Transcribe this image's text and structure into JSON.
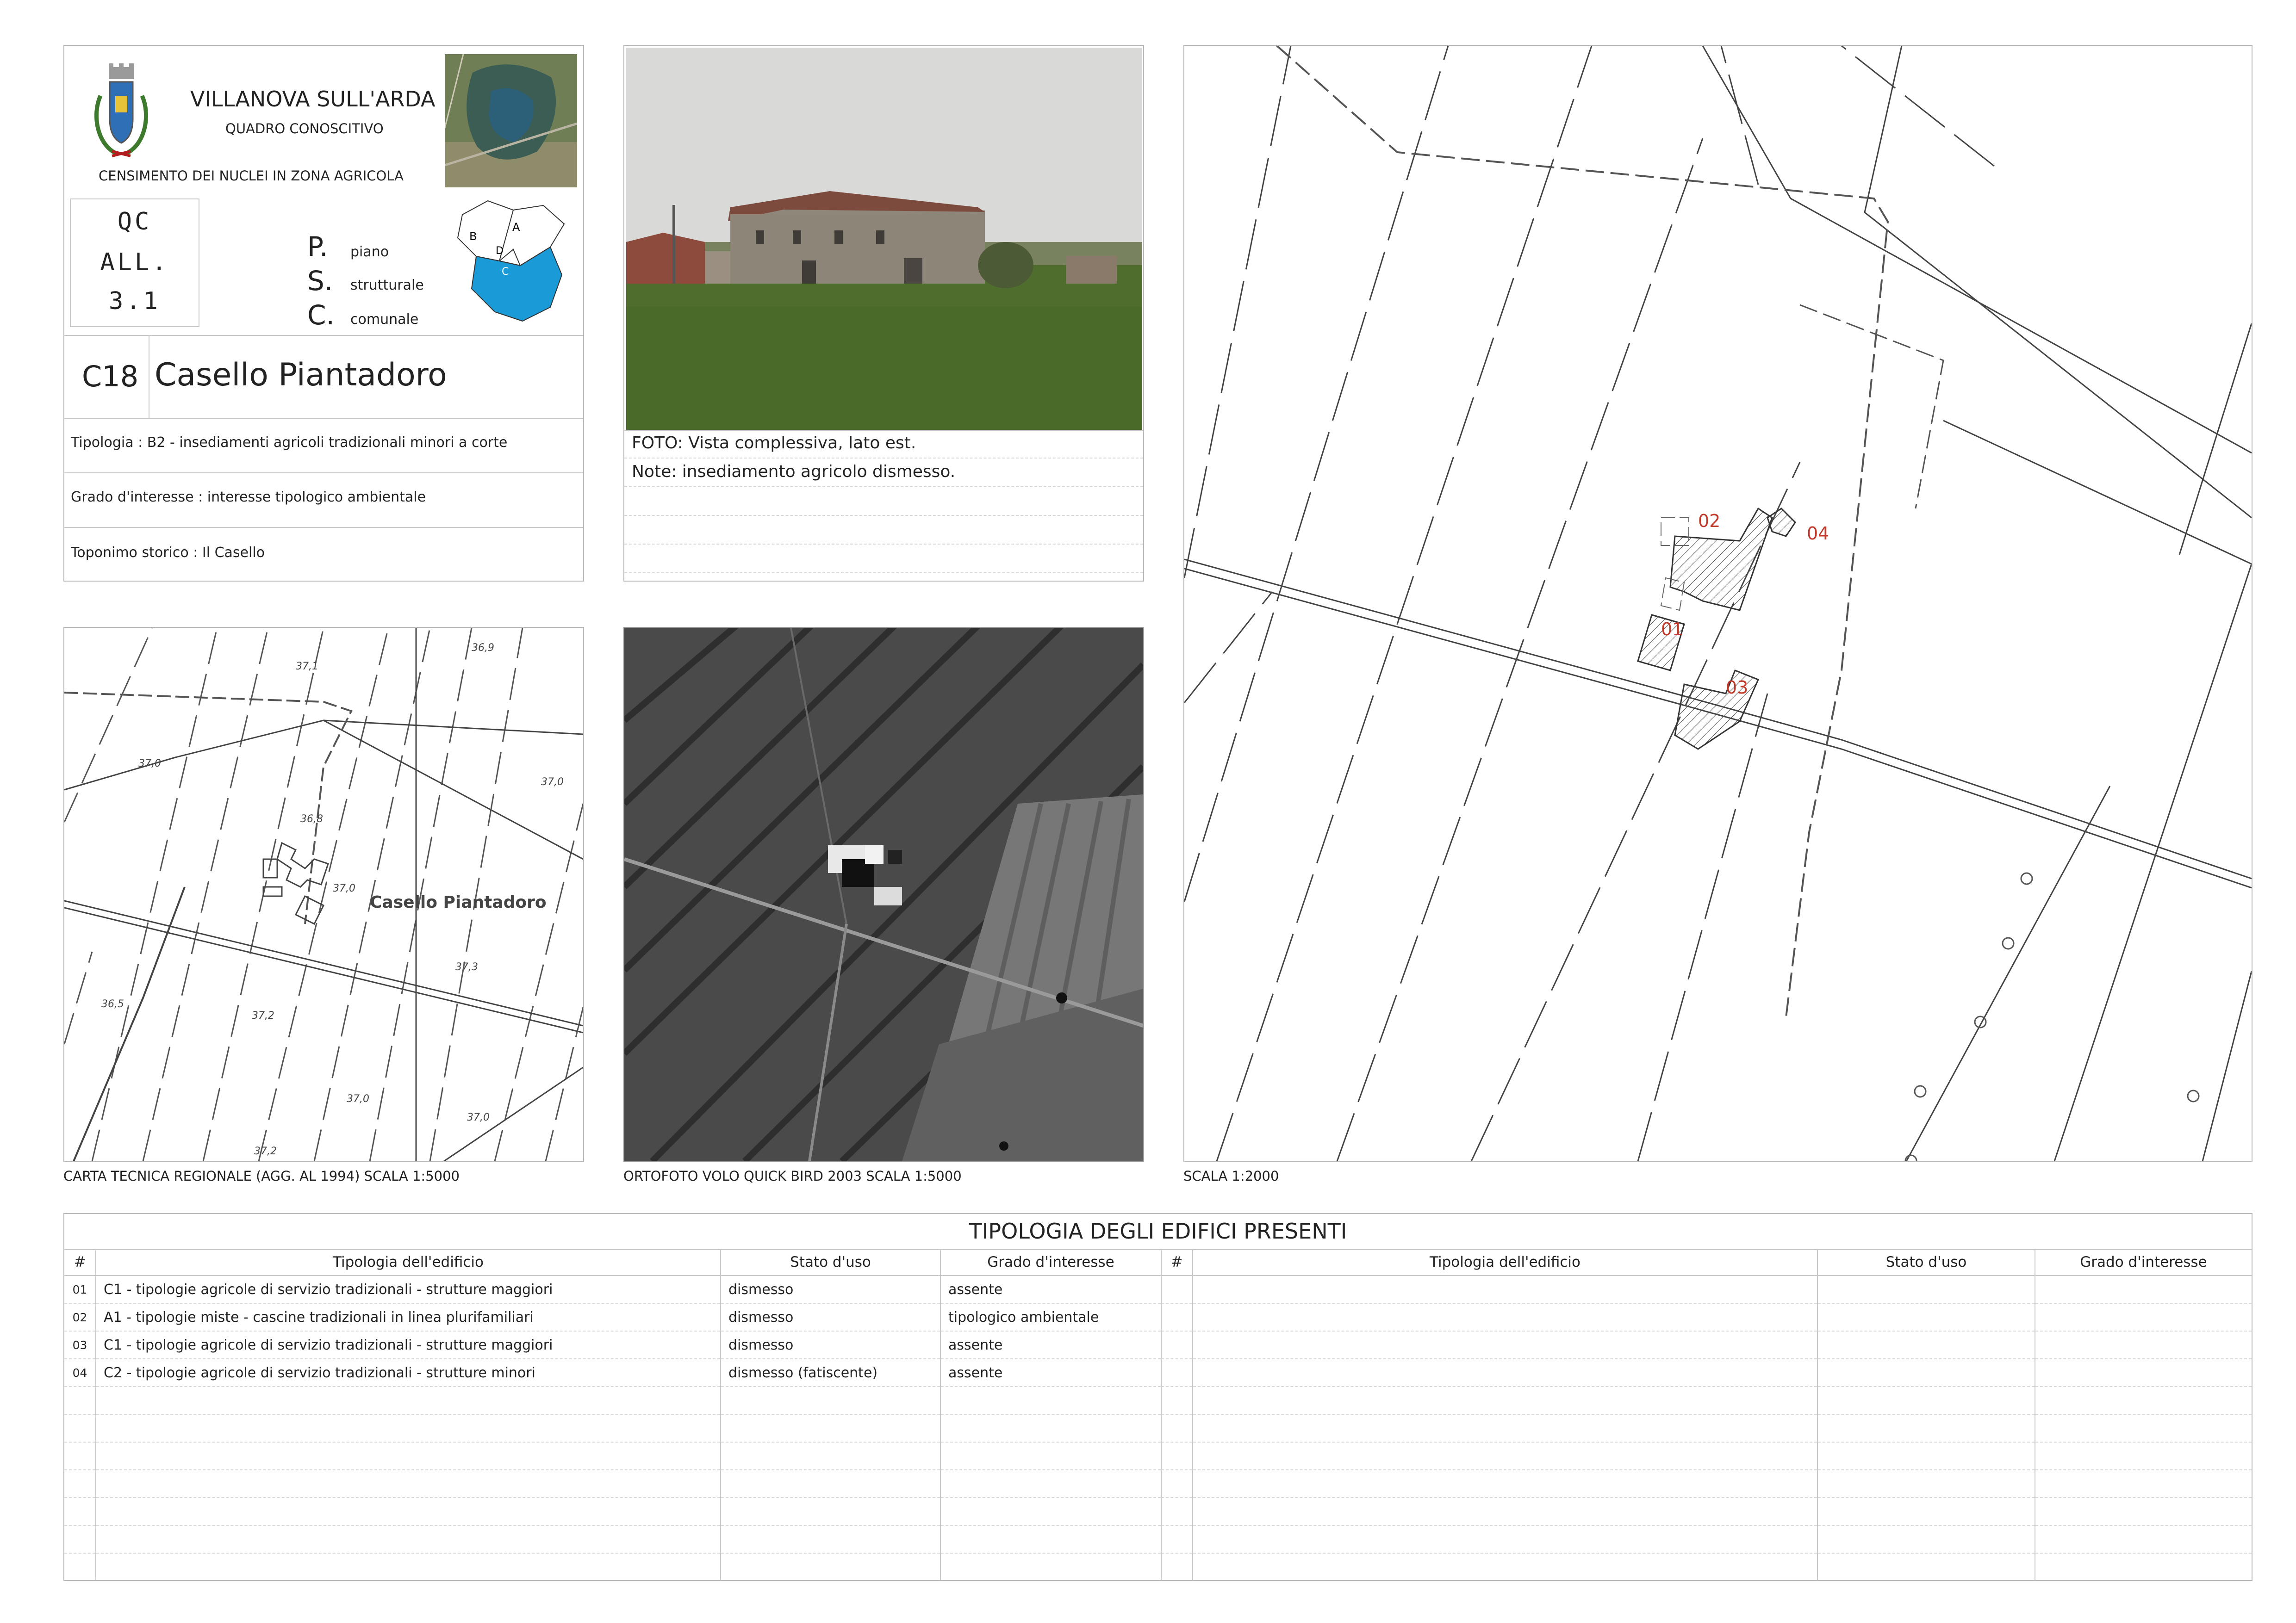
{
  "header": {
    "municipality": "VILLANOVA SULL'ARDA",
    "subtitle": "QUADRO CONOSCITIVO",
    "census_title": "CENSIMENTO DEI NUCLEI IN ZONA AGRICOLA",
    "qc_code": [
      "QC",
      "ALL.",
      "3.1"
    ],
    "psc_letters": [
      "P.",
      "S.",
      "C."
    ],
    "psc_words": [
      "piano",
      "strutturale",
      "comunale"
    ],
    "key_map_labels": [
      "A",
      "B",
      "C",
      "D"
    ]
  },
  "record": {
    "code": "C18",
    "name": "Casello Piantadoro",
    "tipologia": "Tipologia : B2 - insediamenti agricoli tradizionali minori a corte",
    "grado": "Grado d'interesse : interesse tipologico ambientale",
    "toponimo": "Toponimo storico : Il Casello"
  },
  "photo": {
    "caption": "FOTO: Vista complessiva, lato est.",
    "note": "Note: insediamento agricolo dismesso."
  },
  "panels": {
    "ctr_caption": "CARTA TECNICA REGIONALE (AGG. AL 1994) SCALA 1:5000",
    "ortho_caption": "ORTOFOTO VOLO QUICK BIRD 2003 SCALA 1:5000",
    "scale_caption": "SCALA 1:2000",
    "ctr_place_label": "Casello Piantadoro",
    "ctr_elevations": [
      "37,1",
      "36,9",
      "37,0",
      "37,0",
      "36,8",
      "37,0",
      "37,3",
      "36,5",
      "37,2",
      "37,0",
      "37,0",
      "37,2"
    ],
    "building_labels": [
      "01",
      "02",
      "03",
      "04"
    ]
  },
  "table": {
    "title": "TIPOLOGIA DEGLI EDIFICI PRESENTI",
    "columns": [
      "#",
      "Tipologia dell'edificio",
      "Stato d'uso",
      "Grado d'interesse"
    ],
    "rows": [
      {
        "num": "01",
        "tipologia": "C1 - tipologie agricole di servizio tradizionali - strutture maggiori",
        "stato": "dismesso",
        "grado": "assente"
      },
      {
        "num": "02",
        "tipologia": "A1 - tipologie miste - cascine tradizionali in linea plurifamiliari",
        "stato": "dismesso",
        "grado": "tipologico ambientale"
      },
      {
        "num": "03",
        "tipologia": "C1 - tipologie agricole di servizio tradizionali - strutture maggiori",
        "stato": "dismesso",
        "grado": "assente"
      },
      {
        "num": "04",
        "tipologia": "C2 - tipologie agricole di servizio tradizionali - strutture minori",
        "stato": "dismesso (fatiscente)",
        "grado": "assente"
      }
    ]
  },
  "colors": {
    "border": "#b8b8b8",
    "label_red": "#c0392b",
    "key_map_blue": "#1a9ad6"
  },
  "icons": {
    "coat_of_arms": "coat-of-arms-icon"
  }
}
